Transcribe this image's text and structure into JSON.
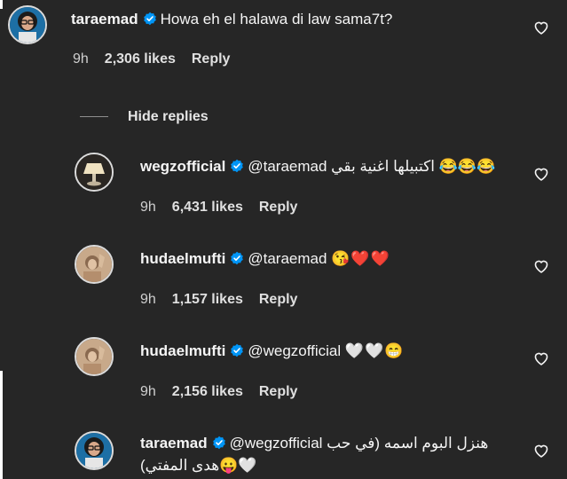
{
  "colors": {
    "background": "#262626",
    "text": "#f5f5f5",
    "muted": "#a8a8a8",
    "verified": "#0095f6"
  },
  "comments": [
    {
      "username": "taraemad",
      "verified": true,
      "text": "Howa eh el halawa di law sama7t?",
      "time": "9h",
      "likes": "2,306 likes",
      "reply": "Reply",
      "avatar_icon": "avatar-woman-glasses"
    }
  ],
  "hide_replies_label": "Hide replies",
  "replies": [
    {
      "username": "wegzofficial",
      "verified": true,
      "mention": "@taraemad",
      "text": "اكتبيلها اغنية بقي",
      "emoji": "😂😂😂",
      "time": "9h",
      "likes": "6,431 likes",
      "reply": "Reply",
      "avatar_icon": "avatar-lamp"
    },
    {
      "username": "hudaelmufti",
      "verified": true,
      "mention": "@taraemad",
      "emoji": "😘❤️❤️",
      "time": "9h",
      "likes": "1,157 likes",
      "reply": "Reply",
      "avatar_icon": "avatar-woman-sepia"
    },
    {
      "username": "hudaelmufti",
      "verified": true,
      "mention": "@wegzofficial",
      "emoji": "🤍🤍😁",
      "time": "9h",
      "likes": "2,156 likes",
      "reply": "Reply",
      "avatar_icon": "avatar-woman-sepia"
    },
    {
      "username": "taraemad",
      "verified": true,
      "mention": "@wegzofficial",
      "text_line1": "هنزل البوم اسمه (في حب",
      "text_line2": "🤍😛هدى المفتي)",
      "avatar_icon": "avatar-woman-glasses"
    }
  ],
  "icons": {
    "like": "heart-outline-icon",
    "verified": "verified-badge-icon"
  }
}
